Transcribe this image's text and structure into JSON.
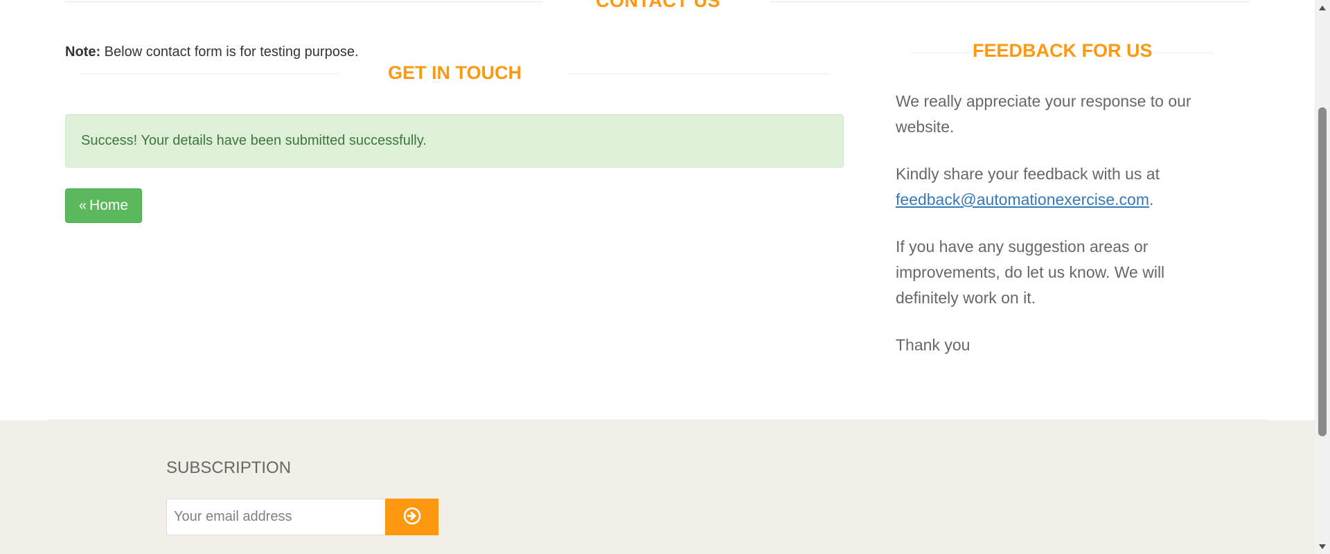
{
  "contact_section": {
    "title": "CONTACT US"
  },
  "note": {
    "label": "Note:",
    "text": " Below contact form is for testing purpose."
  },
  "get_in_touch": {
    "title": "GET IN TOUCH",
    "success_message": "Success! Your details have been submitted successfully.",
    "home_button_label": "Home",
    "home_button_icon": "double-chevron-left-icon"
  },
  "feedback": {
    "title": "FEEDBACK FOR US",
    "p1": "We really appreciate your response to our website.",
    "p2_before": "Kindly share your feedback with us at ",
    "p2_link": "feedback@automationexercise.com",
    "p2_after": ".",
    "p3": "If you have any suggestion areas or improvements, do let us know. We will definitely work on it.",
    "p4": "Thank you"
  },
  "footer": {
    "subscription_title": "SUBSCRIPTION",
    "email_placeholder": "Your email address",
    "subscribe_icon": "arrow-circle-right-icon"
  },
  "colors": {
    "accent": "#FE980F",
    "success_bg": "#dff0d8",
    "success_text": "#3c763d",
    "home_button": "#5cb85c",
    "link": "#337ab7",
    "footer_bg": "#f0f0e9",
    "body_text": "#696763"
  }
}
